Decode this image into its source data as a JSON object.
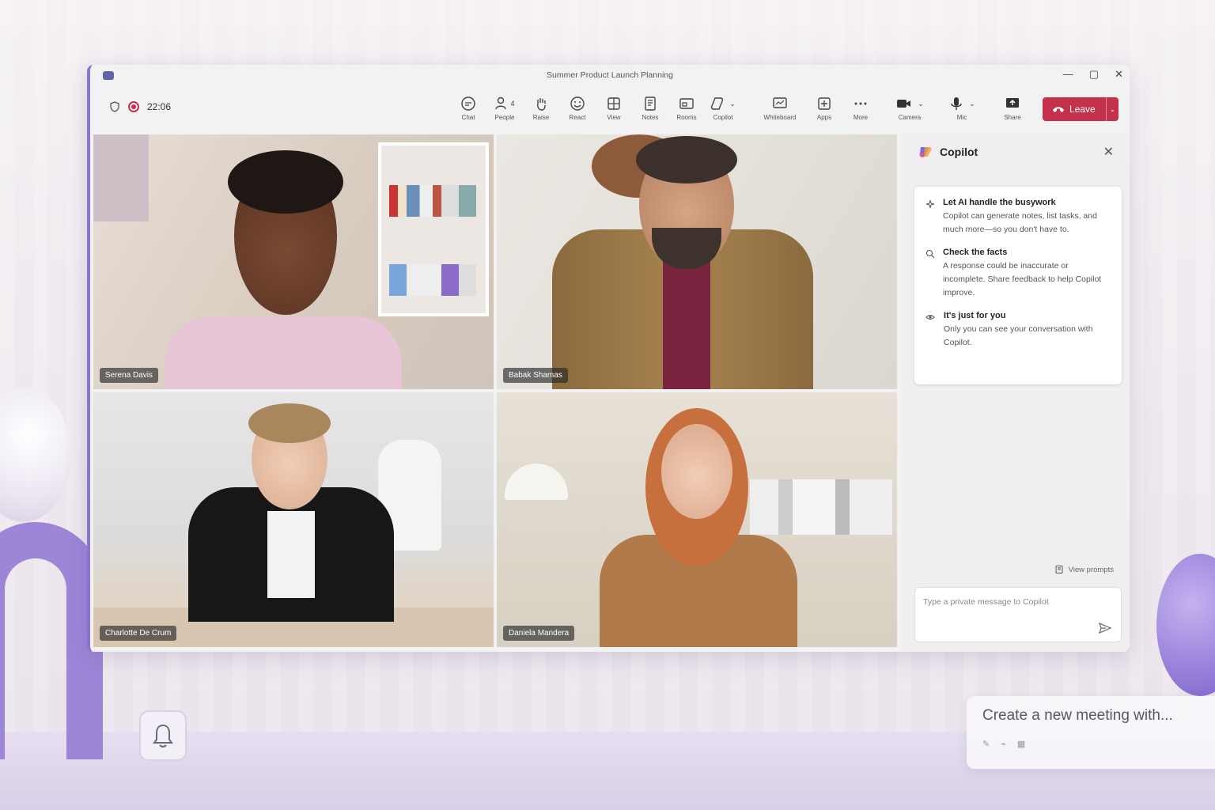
{
  "window": {
    "title": "Summer Product Launch Planning",
    "controls": [
      "—",
      "▢",
      "✕"
    ]
  },
  "meeting": {
    "timer": "22:06"
  },
  "toolbar": {
    "chat_label": "Chat",
    "people_label": "People",
    "people_count": "4",
    "raise_label": "Raise",
    "react_label": "React",
    "view_label": "View",
    "notes_label": "Notes",
    "rooms_label": "Rooms",
    "copilot_label": "Copilot",
    "whiteboard_label": "Whiteboard",
    "apps_label": "Apps",
    "more_label": "More",
    "camera_label": "Camera",
    "mic_label": "Mic",
    "share_label": "Share",
    "leave_label": "Leave"
  },
  "participants": [
    {
      "name": "Serena Davis"
    },
    {
      "name": "Babak Shamas"
    },
    {
      "name": "Charlotte De Crum"
    },
    {
      "name": "Daniela Mandera"
    }
  ],
  "copilot": {
    "title": "Copilot",
    "items": [
      {
        "title": "Let AI handle the busywork",
        "desc": "Copilot can generate notes, list tasks, and much more—so you don't have to."
      },
      {
        "title": "Check the facts",
        "desc": "A response could be inaccurate or incomplete. Share feedback to help Copilot improve."
      },
      {
        "title": "It's just for you",
        "desc": "Only you can see your conversation with Copilot."
      }
    ],
    "view_prompts": "View prompts",
    "input_placeholder": "Type a private message to Copilot"
  },
  "suggestion": {
    "text": "Create a new meeting with..."
  },
  "colors": {
    "accent": "#8b73d6",
    "leave": "#c4314b",
    "teams": "#6264a7"
  }
}
